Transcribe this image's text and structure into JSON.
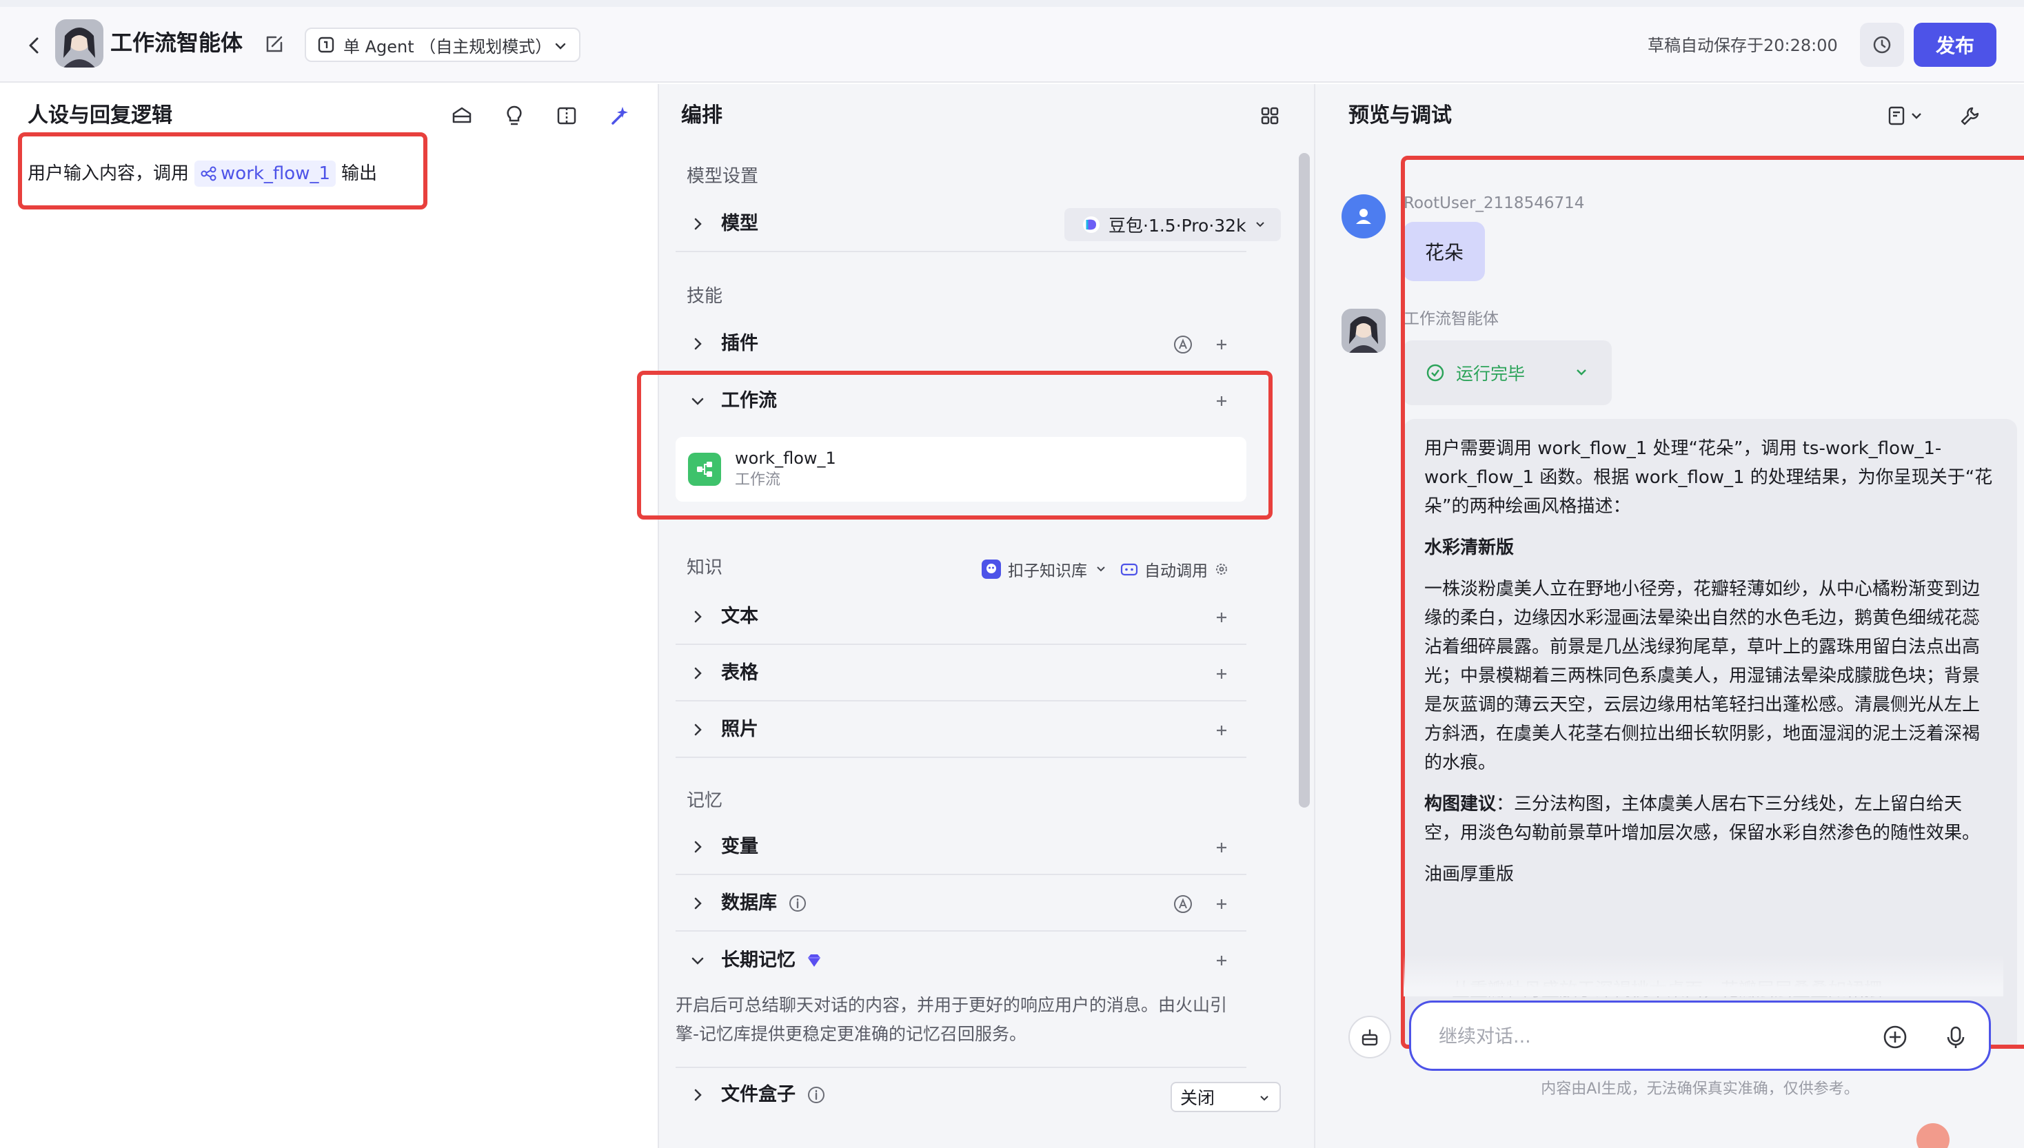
{
  "header": {
    "title": "工作流智能体",
    "mode_label": "单 Agent （自主规划模式）",
    "saved_text": "草稿自动保存于20:28:00",
    "publish_label": "发布"
  },
  "persona": {
    "title": "人设与回复逻辑",
    "text_before": "用户输入内容，调用",
    "workflow_chip": "work_flow_1",
    "text_after": "输出"
  },
  "arrange": {
    "title": "编排",
    "model_group": "模型设置",
    "model_label": "模型",
    "model_value": "豆包·1.5·Pro·32k",
    "skill_group": "技能",
    "plugin_label": "插件",
    "workflow_label": "工作流",
    "workflow_item_name": "work_flow_1",
    "workflow_item_type": "工作流",
    "knowledge_group": "知识",
    "kb_source": "扣子知识库",
    "kb_call": "自动调用",
    "text_label": "文本",
    "table_label": "表格",
    "photo_label": "照片",
    "memory_group": "记忆",
    "variable_label": "变量",
    "database_label": "数据库",
    "ltm_label": "长期记忆",
    "ltm_desc": "开启后可总结聊天对话的内容，并用于更好的响应用户的消息。由火山引擎-记忆库提供更稳定更准确的记忆召回服务。",
    "filebox_label": "文件盒子",
    "filebox_value": "关闭"
  },
  "preview": {
    "title": "预览与调试",
    "user_name": "RootUser_2118546714",
    "user_message": "花朵",
    "bot_name": "工作流智能体",
    "run_status": "运行完毕",
    "answer_p1": "用户需要调用 work_flow_1 处理“花朵”，调用 ts-work_flow_1-work_flow_1 函数。根据 work_flow_1 的处理结果，为你呈现关于“花朵”的两种绘画风格描述：",
    "answer_h1": "水彩清新版",
    "answer_p2": "一株淡粉虞美人立在野地小径旁，花瓣轻薄如纱，从中心橘粉渐变到边缘的柔白，边缘因水彩湿画法晕染出自然的水色毛边，鹅黄色细绒花蕊沾着细碎晨露。前景是几丛浅绿狗尾草，草叶上的露珠用留白法点出高光；中景模糊着三两株同色系虞美人，用湿铺法晕染成朦胧色块；背景是灰蓝调的薄云天空，云层边缘用枯笔轻扫出蓬松感。清晨侧光从左上方斜洒，在虞美人花茎右侧拉出细长软阴影，地面湿润的泥土泛着深褐的水痕。",
    "answer_comp_label": "构图建议",
    "answer_comp_text": "：三分法构图，主体虞美人居右下三分线处，左上留白给天空，用淡色勾勒前景草叶增加层次感，保留水彩自然渗色的随性效果。",
    "answer_h2": "油画厚重版",
    "answer_ghost": "一丛重瓣牡丹盛放于深褐桃木桌面，花瓣层层叠叠如裙摆",
    "input_placeholder": "继续对话...",
    "footer_note": "内容由AI生成，无法确保真实准确，仅供参考。"
  },
  "colors": {
    "accent": "#4d53e8",
    "highlight_border": "#e8403d",
    "success": "#2ba359",
    "workflow_icon": "#3ec26b"
  }
}
